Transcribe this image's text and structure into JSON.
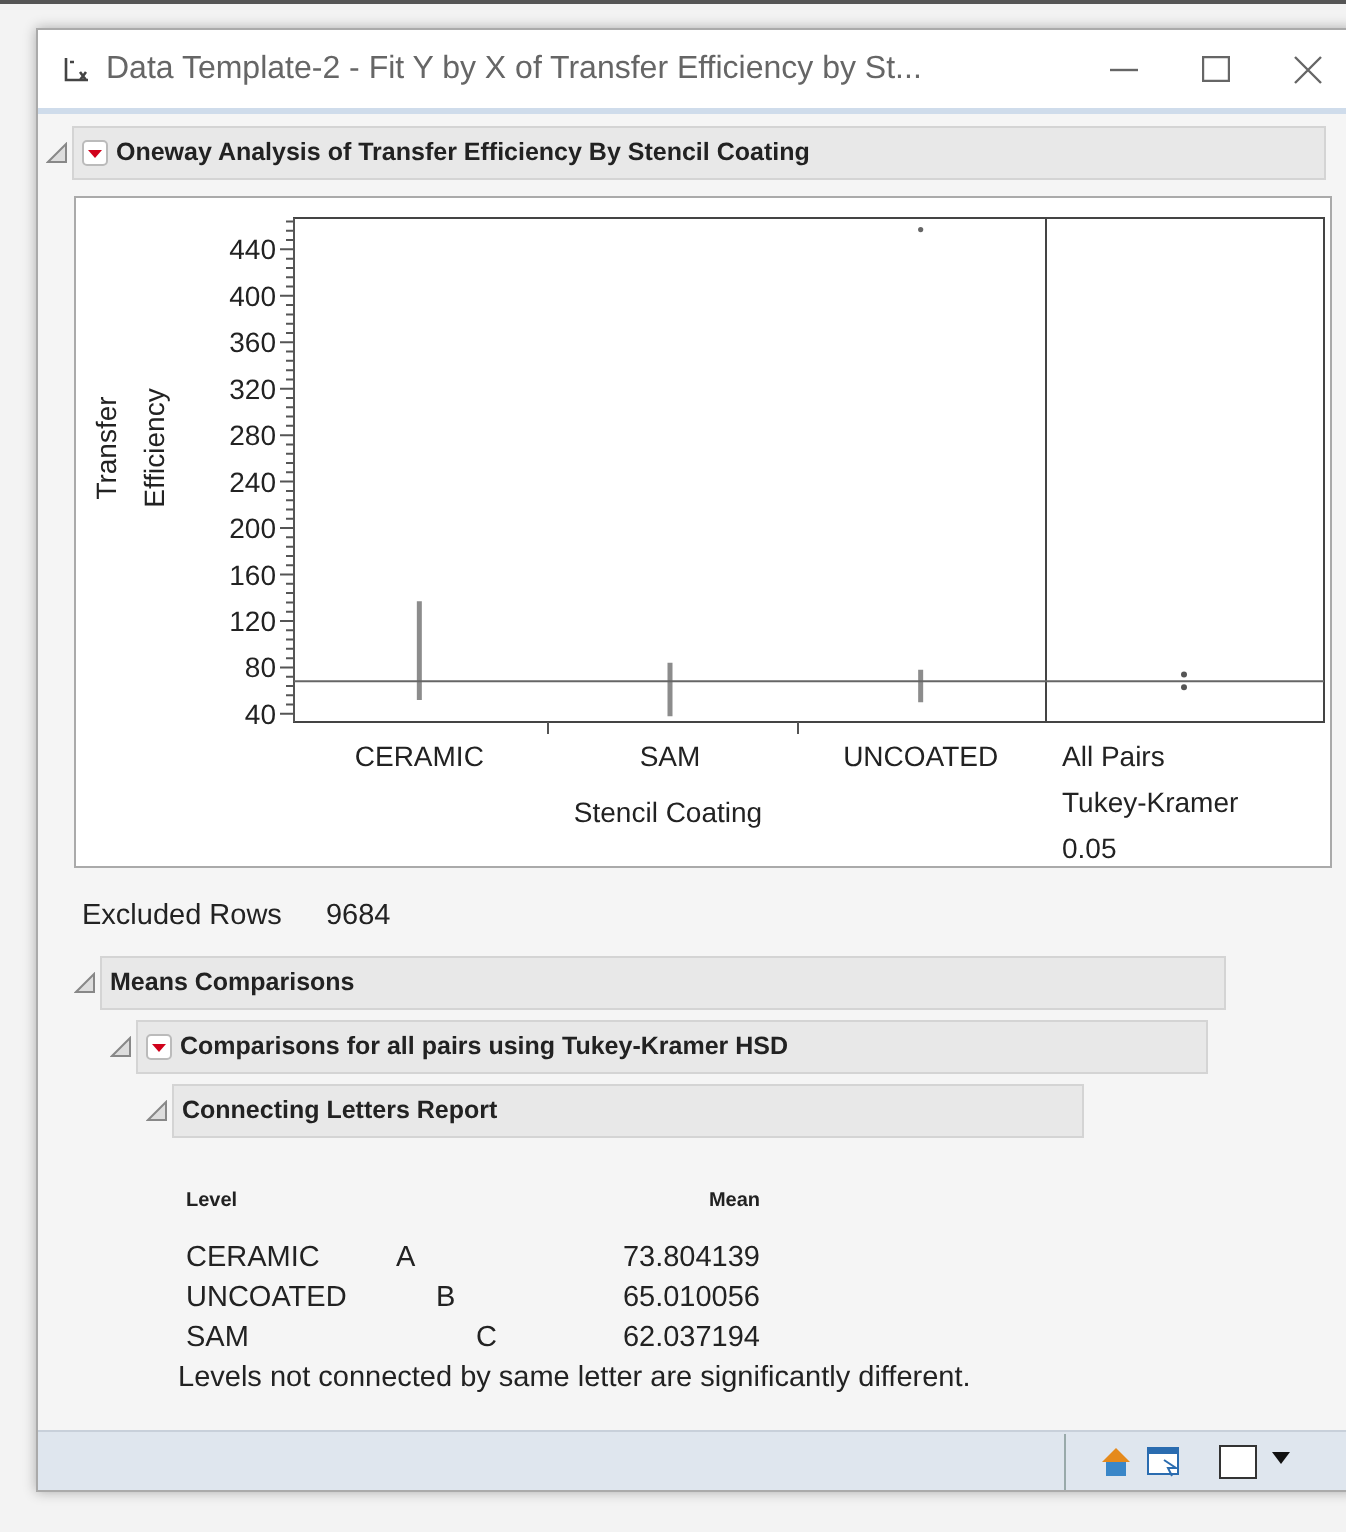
{
  "window": {
    "title": "Data Template-2 - Fit Y by X of Transfer Efficiency by St..."
  },
  "report": {
    "title": "Oneway Analysis of Transfer Efficiency By Stencil Coating",
    "expanded": true,
    "plot": {
      "x_axis_title": "Stencil Coating",
      "y_axis_title": "Transfer Efficiency",
      "categories": [
        "CERAMIC",
        "SAM",
        "UNCOATED"
      ],
      "y_tick_labels": [
        "440",
        "400",
        "360",
        "320",
        "280",
        "240",
        "200",
        "160",
        "120",
        "80",
        "40"
      ]
    },
    "comparison_labels": [
      "All Pairs",
      "Tukey-Kramer",
      "0.05"
    ],
    "excluded_rows": {
      "label": "Excluded Rows",
      "value": "9684"
    },
    "means_comparisons": {
      "title": "Means Comparisons",
      "expanded": true,
      "comparisons": {
        "title": "Comparisons for all pairs using Tukey-Kramer HSD",
        "expanded": true,
        "connecting_letters": {
          "title": "Connecting Letters Report",
          "expanded": true,
          "columns": [
            "Level",
            "Mean"
          ],
          "rows": [
            {
              "level": "CERAMIC",
              "column_2": "A",
              "mean": "73.804139"
            },
            {
              "level": "UNCOATED",
              "column_3": "B",
              "mean": "65.010056"
            },
            {
              "level": "SAM",
              "column_4": "C",
              "mean": "62.037194"
            }
          ],
          "note": "Levels not connected by same letter are significantly different."
        }
      }
    }
  }
}
